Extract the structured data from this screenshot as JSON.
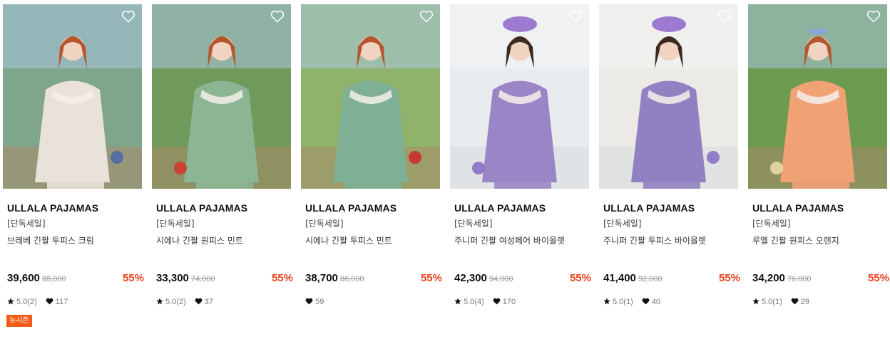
{
  "products": [
    {
      "brand": "ULLALA PAJAMAS",
      "promo": "[단독세일]",
      "name": "브레베 긴팔 투피스 크림",
      "price": "39,600",
      "original_price": "88,000",
      "discount": "55%",
      "rating": "5.0(2)",
      "likes": "117",
      "tag": "뉴시즌",
      "colors": {
        "bg": "#7fa58a",
        "garment": "#e8e2d8",
        "accent": "#4b6aa5"
      }
    },
    {
      "brand": "ULLALA PAJAMAS",
      "promo": "[단독세일]",
      "name": "시에나 긴팔 원피스 민트",
      "price": "33,300",
      "original_price": "74,000",
      "discount": "55%",
      "rating": "5.0(2)",
      "likes": "37",
      "colors": {
        "bg": "#6f9a5c",
        "garment": "#8cb594",
        "accent": "#d23a2f"
      }
    },
    {
      "brand": "ULLALA PAJAMAS",
      "promo": "[단독세일]",
      "name": "시에나 긴팔 투피스 민트",
      "price": "38,700",
      "original_price": "86,000",
      "discount": "55%",
      "likes": "59",
      "colors": {
        "bg": "#8fb36a",
        "garment": "#7fb095",
        "accent": "#c9302a"
      }
    },
    {
      "brand": "ULLALA PAJAMAS",
      "promo": "[단독세일]",
      "name": "주니퍼 긴팔 여성페어 바이올렛",
      "price": "42,300",
      "original_price": "94,000",
      "discount": "55%",
      "rating": "5.0(4)",
      "likes": "170",
      "colors": {
        "bg": "#e9ecef",
        "garment": "#9a86c6",
        "accent": "#8a6fc4"
      }
    },
    {
      "brand": "ULLALA PAJAMAS",
      "promo": "[단독세일]",
      "name": "주니퍼 긴팔 투피스 바이올렛",
      "price": "41,400",
      "original_price": "92,000",
      "discount": "55%",
      "rating": "5.0(1)",
      "likes": "40",
      "colors": {
        "bg": "#eceae6",
        "garment": "#9281c2",
        "accent": "#8a6fc4"
      }
    },
    {
      "brand": "ULLALA PAJAMAS",
      "promo": "[단독세일]",
      "name": "루엘 긴팔 원피스 오렌지",
      "price": "34,200",
      "original_price": "76,000",
      "discount": "55%",
      "rating": "5.0(1)",
      "likes": "29",
      "colors": {
        "bg": "#6c9a4e",
        "garment": "#f0a275",
        "accent": "#e7d9a8"
      }
    }
  ],
  "colors": {
    "discount": "#e8431e",
    "tag_bg": "#f25c18"
  },
  "icons": {
    "wishlist": "heart-outline-icon",
    "rating": "star-icon",
    "likes": "heart-icon"
  }
}
